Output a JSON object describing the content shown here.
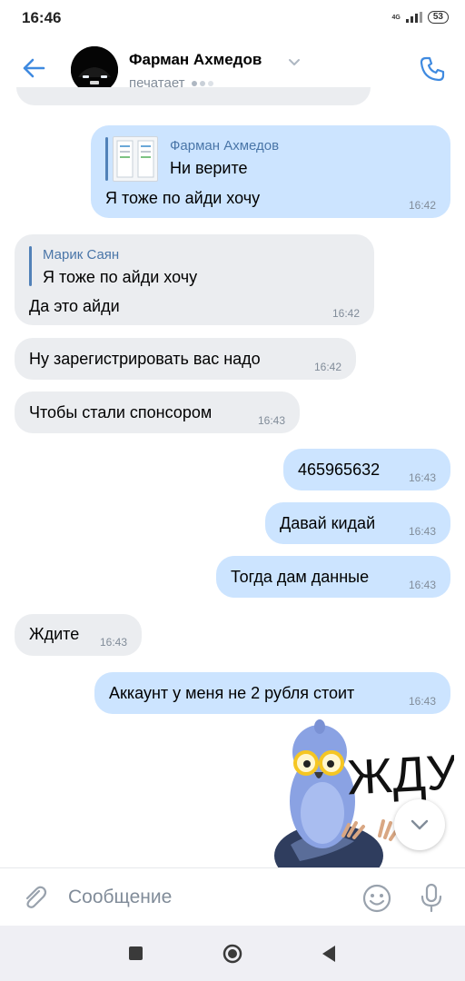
{
  "status_bar": {
    "time": "16:46",
    "network": "4G",
    "battery": "53"
  },
  "header": {
    "contact_name": "Фарман Ахмедов",
    "status": "печатает"
  },
  "messages": [
    {
      "dir": "out",
      "reply_name": "Фарман Ахмедов",
      "reply_text": "Ни верите",
      "text": "Я тоже по айди хочу",
      "time": "16:42"
    },
    {
      "dir": "in",
      "reply_name": "Марик Саян",
      "reply_text": "Я тоже по айди хочу",
      "text": "Да это айди",
      "time": "16:42"
    },
    {
      "dir": "in",
      "text": "Ну зарегистрировать вас надо",
      "time": "16:42"
    },
    {
      "dir": "in",
      "text": "Чтобы стали спонсором",
      "time": "16:43"
    },
    {
      "dir": "out",
      "text": "465965632",
      "time": "16:43"
    },
    {
      "dir": "out",
      "text": "Давай кидай",
      "time": "16:43"
    },
    {
      "dir": "out",
      "text": "Тогда дам данные",
      "time": "16:43"
    },
    {
      "dir": "in",
      "text": "Ждите",
      "time": "16:43"
    },
    {
      "dir": "out",
      "text": "Аккаунт у меня не 2 рубля стоит",
      "time": "16:43"
    }
  ],
  "sticker": {
    "text": "ЖДУ"
  },
  "composer": {
    "placeholder": "Сообщение"
  },
  "colors": {
    "accent": "#3f8ae0",
    "incoming": "#ebedf0",
    "outgoing": "#cce4ff"
  },
  "icons": [
    "back-arrow-icon",
    "chevron-down-icon",
    "phone-icon",
    "paperclip-icon",
    "emoji-icon",
    "microphone-icon",
    "scroll-down-icon"
  ]
}
